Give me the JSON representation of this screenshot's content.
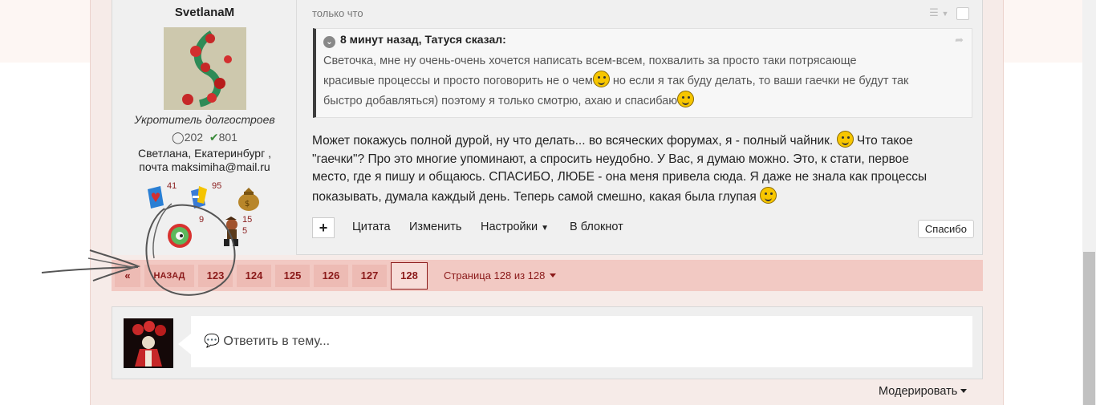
{
  "author": {
    "name": "SvetlanaM",
    "title": "Укротитель долгостроев",
    "posts": "202",
    "reputation": "801",
    "location": "Светлана, Екатеринбург ,",
    "email": "почта maksimiha@mail.ru",
    "awards": [
      {
        "icon": "heart-book-award-icon",
        "count": "41"
      },
      {
        "icon": "book-pencil-award-icon",
        "count": "95"
      },
      {
        "icon": "money-bag-award-icon",
        "count": ""
      },
      {
        "icon": "gear-award-icon",
        "count": "9"
      },
      {
        "icon": "cat-in-boots-award-icon",
        "count": "15"
      },
      {
        "icon": "extra-award-count",
        "count": "5"
      }
    ]
  },
  "post": {
    "time": "только что",
    "quote": {
      "header": "8 минут назад, Татуся сказал:",
      "line1": "Светочка, мне ну очень-очень хочется написать всем-всем, похвалить за просто таки потрясающе",
      "line2a": "красивые процессы и просто поговорить не о чем",
      "line2b": " но если я так буду делать, то ваши гаечки не будут так",
      "line3": "быстро добавляться) поэтому я только смотрю, ахаю и спасибаю"
    },
    "body": {
      "line1": "Может покажусь полной дурой, ну что делать... во всяческих форумах, я - полный чайник. ",
      "line1b": " Что такое",
      "line2": "\"гаечки\"? Про это многие упоминают, а спросить неудобно.  У Вас, я думаю можно. Это, к стати, первое",
      "line3": "место, где я пишу и общаюсь. СПАСИБО, ЛЮБЕ - она меня привела сюда. Я даже не знала как процессы",
      "line4": "показывать, думала каждый день. Теперь самой смешно, какая была глупая"
    },
    "actions": {
      "plus": "+",
      "quote": "Цитата",
      "edit": "Изменить",
      "settings": "Настройки",
      "notepad": "В блокнот",
      "thanks": "Спасибо"
    }
  },
  "pagination": {
    "first": "«",
    "prev": "НАЗАД",
    "pages": [
      "123",
      "124",
      "125",
      "126",
      "127",
      "128"
    ],
    "current": "128",
    "info": "Страница 128 из 128"
  },
  "reply": {
    "placeholder": "Ответить в тему..."
  },
  "moderate": "Модерировать",
  "colors": {
    "accent": "#8b1a1a",
    "pagination_bg": "#f2c9c3",
    "success": "#3a8a3a"
  }
}
